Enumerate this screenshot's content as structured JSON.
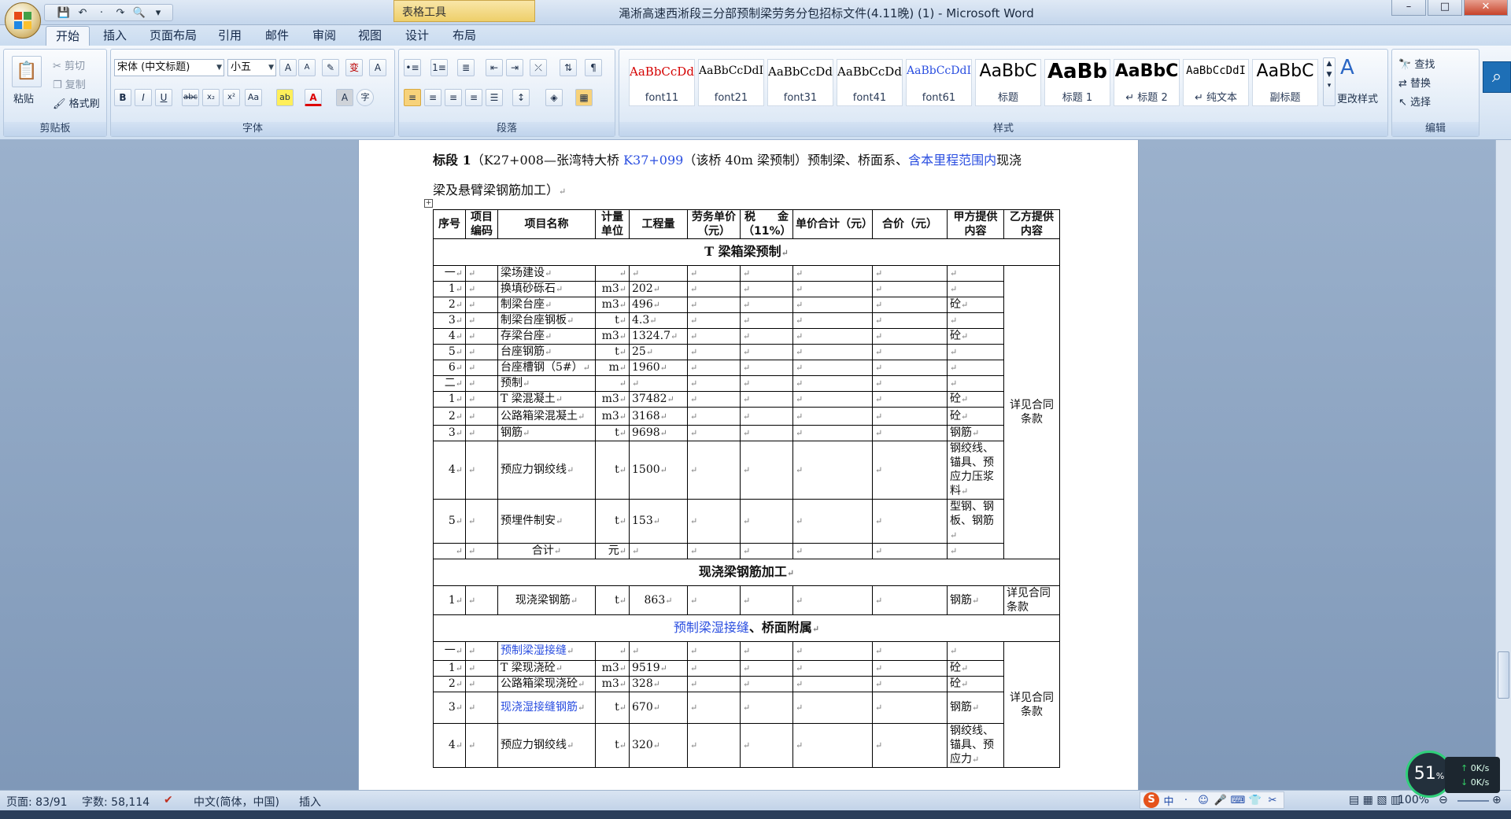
{
  "window": {
    "title": "渑淅高速西淅段三分部预制梁劳务分包招标文件(4.11晚) (1) - Microsoft Word",
    "context_tab_group": "表格工具",
    "controls": [
      "–",
      "□",
      "✕"
    ]
  },
  "qat": [
    "💾",
    "↶",
    "·",
    "↷",
    "🔍",
    "▾"
  ],
  "tabs": [
    "开始",
    "插入",
    "页面布局",
    "引用",
    "邮件",
    "审阅",
    "视图",
    "设计",
    "布局"
  ],
  "active_tab": "开始",
  "clipboard": {
    "label": "剪贴板",
    "paste": "粘贴",
    "cut": "剪切",
    "copy": "复制",
    "format_painter": "格式刷"
  },
  "font": {
    "label": "字体",
    "name": "宋体 (中文标题)",
    "size": "小五",
    "grow": "A",
    "shrink": "A",
    "clear": "✎",
    "phonetic": "变",
    "border_char": "A",
    "bold": "B",
    "italic": "I",
    "underline": "U",
    "strike": "abc",
    "subscript": "x₂",
    "superscript": "x²",
    "case": "Aa",
    "highlight": "ab",
    "color": "A",
    "shade": "A",
    "enclose": "字"
  },
  "paragraph": {
    "label": "段落"
  },
  "styles": {
    "label": "样式",
    "items": [
      {
        "sample": "AaBbCcDd",
        "name": "font11",
        "color": "#d40000"
      },
      {
        "sample": "AaBbCcDdI",
        "name": "font21",
        "color": "#000000"
      },
      {
        "sample": "AaBbCcDd",
        "name": "font31",
        "color": "#000000"
      },
      {
        "sample": "AaBbCcDd",
        "name": "font41",
        "color": "#000000"
      },
      {
        "sample": "AaBbCcDdI",
        "name": "font61",
        "color": "#2a4ee0"
      },
      {
        "sample": "AaBbC",
        "name": "标题",
        "color": "#000000"
      },
      {
        "sample": "AaBb",
        "name": "标题 1",
        "color": "#000000"
      },
      {
        "sample": "AaBbC",
        "name": "↵ 标题 2",
        "color": "#000000"
      },
      {
        "sample": "AaBbCcDdI",
        "name": "↵ 纯文本",
        "color": "#000000"
      },
      {
        "sample": "AaBbC",
        "name": "副标题",
        "color": "#000000"
      }
    ],
    "change": "更改样式"
  },
  "editing": {
    "label": "编辑",
    "find": "查找",
    "replace": "替换",
    "select": "选择"
  },
  "doc": {
    "head_parts": [
      "标段 1",
      "（K27+008—张湾特大桥 ",
      "K37+099",
      "（该桥 40m 梁预制）预制梁、桥面系、",
      "含本里程范围内",
      "现浇"
    ],
    "head_line2": "梁及悬臂梁钢筋加工）",
    "table": {
      "headers": [
        "序号",
        "项目编码",
        "项目名称",
        "计量单位",
        "工程量",
        "劳务单价（元）",
        "税　　金（11%）",
        "单价合计（元）",
        "合价（元）",
        "甲方提供内容",
        "乙方提供内容"
      ],
      "sections": [
        {
          "title": "T 梁箱梁预制",
          "merged_b": "详见合同条款",
          "rows": [
            [
              "一",
              "",
              "梁场建设",
              "",
              "",
              "",
              "",
              "",
              "",
              ""
            ],
            [
              "1",
              "",
              "换填砂砾石",
              "m3",
              "202",
              "",
              "",
              "",
              "",
              ""
            ],
            [
              "2",
              "",
              "制梁台座",
              "m3",
              "496",
              "",
              "",
              "",
              "",
              "砼"
            ],
            [
              "3",
              "",
              "制梁台座钢板",
              "t",
              "4.3",
              "",
              "",
              "",
              "",
              ""
            ],
            [
              "4",
              "",
              "存梁台座",
              "m3",
              "1324.7",
              "",
              "",
              "",
              "",
              "砼"
            ],
            [
              "5",
              "",
              "台座钢筋",
              "t",
              "25",
              "",
              "",
              "",
              "",
              ""
            ],
            [
              "6",
              "",
              "台座槽钢（5#）",
              "m",
              "1960",
              "",
              "",
              "",
              "",
              ""
            ],
            [
              "二",
              "",
              "预制",
              "",
              "",
              "",
              "",
              "",
              "",
              ""
            ],
            [
              "1",
              "",
              "T 梁混凝土",
              "m3",
              "37482",
              "",
              "",
              "",
              "",
              "砼"
            ],
            [
              "2",
              "",
              "公路箱梁混凝土",
              "m3",
              "3168",
              "",
              "",
              "",
              "",
              "砼"
            ],
            [
              "3",
              "",
              "钢筋",
              "t",
              "9698",
              "",
              "",
              "",
              "",
              "钢筋"
            ],
            [
              "4",
              "",
              "预应力钢绞线",
              "t",
              "1500",
              "",
              "",
              "",
              "",
              "钢绞线、锚具、预应力压浆料"
            ],
            [
              "5",
              "",
              "预埋件制安",
              "t",
              "153",
              "",
              "",
              "",
              "",
              "型钢、钢板、钢筋"
            ],
            [
              "",
              "",
              "合计",
              "元",
              "",
              "",
              "",
              "",
              "",
              ""
            ]
          ]
        },
        {
          "title": "现浇梁钢筋加工",
          "rows": [
            [
              "1",
              "",
              "现浇梁钢筋",
              "t",
              "863",
              "",
              "",
              "",
              "",
              "钢筋",
              "详见合同条款"
            ]
          ]
        },
        {
          "title_blue": "预制梁湿接缝",
          "title_rest": "、桥面附属",
          "merged_b": "详见合同条款",
          "rows": [
            [
              "一",
              "",
              "预制梁湿接缝",
              "",
              "",
              "",
              "",
              "",
              "",
              ""
            ],
            [
              "1",
              "",
              "T 梁现浇砼",
              "m3",
              "9519",
              "",
              "",
              "",
              "",
              "砼"
            ],
            [
              "2",
              "",
              "公路箱梁现浇砼",
              "m3",
              "328",
              "",
              "",
              "",
              "",
              "砼"
            ],
            [
              "3",
              "",
              "现浇湿接缝钢筋",
              "t",
              "670",
              "",
              "",
              "",
              "",
              "钢筋"
            ],
            [
              "4",
              "",
              "预应力钢绞线",
              "t",
              "320",
              "",
              "",
              "",
              "",
              "钢绞线、锚具、预应力"
            ]
          ]
        }
      ]
    }
  },
  "status": {
    "page": "页面: 83/91",
    "words": "字数: 58,114",
    "lang": "中文(简体，中国)",
    "mode": "插入",
    "zoom": "100%"
  },
  "speed": {
    "percent": "51",
    "unit": "%",
    "up": "0K/s",
    "down": "0K/s"
  },
  "ime": [
    "S",
    "中",
    "·",
    "☺",
    "🎤",
    "⌨",
    "👕",
    "✂"
  ]
}
